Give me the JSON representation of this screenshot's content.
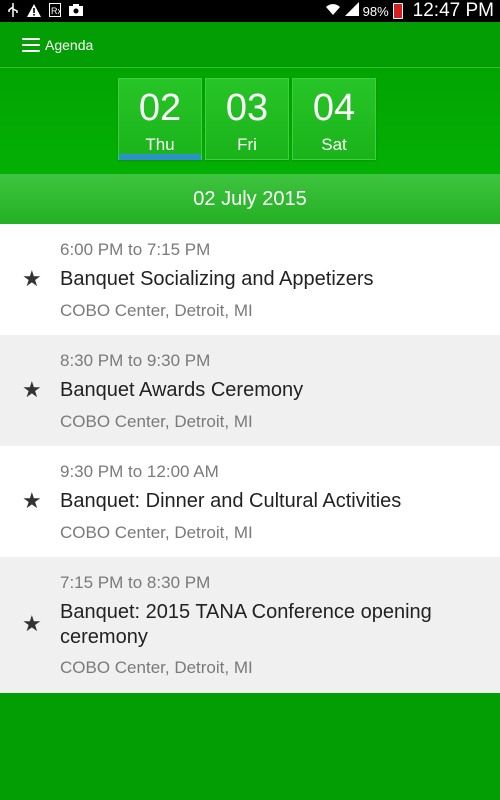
{
  "status_bar": {
    "left_icons": [
      "usb-icon",
      "warning-icon",
      "rx-icon",
      "photo-icon"
    ],
    "battery_percent": "98%",
    "time": "12:47 PM"
  },
  "app_bar": {
    "title": "Agenda",
    "menu_icon": "hamburger-menu-icon"
  },
  "days": [
    {
      "number": "02",
      "weekday": "Thu",
      "selected": true
    },
    {
      "number": "03",
      "weekday": "Fri",
      "selected": false
    },
    {
      "number": "04",
      "weekday": "Sat",
      "selected": false
    }
  ],
  "selected_date": "02 July 2015",
  "events": [
    {
      "time": "6:00 PM to 7:15 PM",
      "title": "Banquet Socializing and Appetizers",
      "location": "COBO Center, Detroit, MI"
    },
    {
      "time": "8:30 PM to 9:30 PM",
      "title": "Banquet Awards Ceremony",
      "location": "COBO Center, Detroit, MI"
    },
    {
      "time": "9:30 PM to 12:00 AM",
      "title": "Banquet: Dinner and Cultural Activities",
      "location": "COBO Center, Detroit, MI"
    },
    {
      "time": "7:15 PM to 8:30 PM",
      "title": "Banquet: 2015 TANA Conference opening ceremony",
      "location": "COBO Center, Detroit, MI"
    }
  ],
  "colors": {
    "primary_green": "#039e03",
    "day_tile_green": "#1ab41a",
    "selected_indicator": "#2b91c6",
    "row_alt": "#f0f0f0"
  }
}
